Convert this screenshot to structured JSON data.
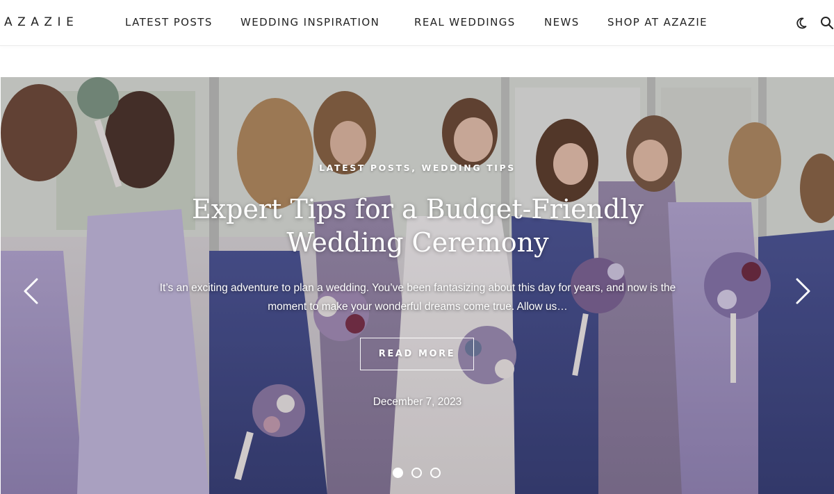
{
  "header": {
    "logo": "AZAZIE",
    "nav": [
      {
        "label": "LATEST POSTS"
      },
      {
        "label": "WEDDING INSPIRATION"
      },
      {
        "label": "REAL WEDDINGS"
      },
      {
        "label": "NEWS"
      },
      {
        "label": "SHOP AT AZAZIE"
      }
    ],
    "icons": [
      "moon-icon",
      "search-icon"
    ]
  },
  "hero": {
    "categories": "LATEST POSTS, WEDDING TIPS",
    "title": "Expert Tips for a Budget-Friendly Wedding Ceremony",
    "excerpt": "It’s an exciting adventure to plan a wedding. You’ve been fantasizing about this day for years, and now is the moment to make your wonderful dreams come true. Allow us…",
    "read_more": "READ MORE",
    "date": "December 7, 2023",
    "slides": {
      "count": 3,
      "active": 1
    }
  },
  "colors": {
    "header_bg": "#ffffff",
    "nav_text": "#222222",
    "overlay_text": "#ffffff",
    "dress_lilac": "#a69bc6",
    "dress_navy": "#3e4a86"
  }
}
